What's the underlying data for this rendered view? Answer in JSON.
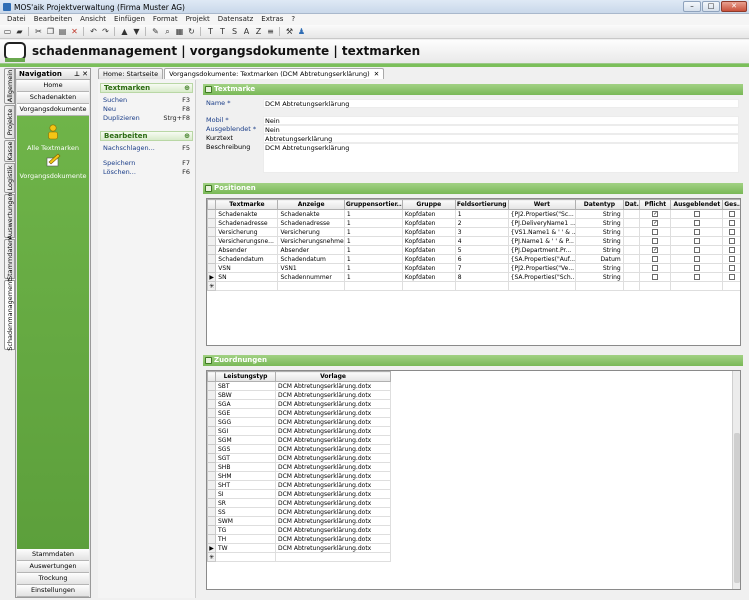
{
  "window": {
    "title": "MOS'aik Projektverwaltung (Firma Muster AG)"
  },
  "menu": [
    "Datei",
    "Bearbeiten",
    "Ansicht",
    "Einfügen",
    "Format",
    "Projekt",
    "Datensatz",
    "Extras",
    "?"
  ],
  "header": {
    "title": "schadenmanagement | vorgangsdokumente | textmarken"
  },
  "vtabs": [
    "Allgemein",
    "Projekte",
    "Kasse",
    "Logistik",
    "Auswertungen",
    "Stammdaten",
    "Schadenmanagement"
  ],
  "nav": {
    "title": "Navigation",
    "pin": "† ‡",
    "top_buttons": [
      "Home",
      "Schadenakten",
      "Vorgangsdokumente"
    ],
    "items": [
      {
        "label": "Alle Textmarken",
        "icon": "person-icon"
      },
      {
        "label": "Vorgangsdokumente",
        "icon": "pen-document-icon"
      }
    ],
    "bottom_buttons": [
      "Stammdaten",
      "Auswertungen",
      "Trockung",
      "Einstellungen"
    ]
  },
  "tabs": [
    {
      "label": "Home: Startseite"
    },
    {
      "label": "Vorgangsdokumente: Textmarken (DCM Abtretungserklärung)"
    }
  ],
  "actions": {
    "group1": {
      "title": "Textmarken",
      "rows": [
        {
          "label": "Suchen",
          "key": "F3"
        },
        {
          "label": "Neu",
          "key": "F8"
        },
        {
          "label": "Duplizieren",
          "key": "Strg+F8"
        }
      ]
    },
    "group2": {
      "title": "Bearbeiten",
      "rows": [
        {
          "label": "Nachschlagen...",
          "key": "F5"
        },
        {
          "label": "Speichern",
          "key": "F7"
        },
        {
          "label": "Löschen...",
          "key": "F6"
        }
      ]
    }
  },
  "textmarke": {
    "title": "Textmarke",
    "name_label": "Name *",
    "name_value": "DCM Abtretungserklärung",
    "mobil_label": "Mobil *",
    "mobil_value": "Nein",
    "ausgeblendet_label": "Ausgeblendet *",
    "ausgeblendet_value": "Nein",
    "kurztext_label": "Kurztext",
    "kurztext_value": "Abtretungserklärung",
    "beschreibung_label": "Beschreibung",
    "beschreibung_value": "DCM Abtretungserklärung"
  },
  "positionen": {
    "title": "Positionen",
    "columns": [
      "Textmarke",
      "Anzeige",
      "Gruppensortier...",
      "Gruppe",
      "Feldsortierung",
      "Wert",
      "Datentyp",
      "Dat...",
      "Pflicht",
      "Ausgeblendet",
      "Ges..."
    ],
    "rows": [
      [
        "Schadenakte",
        "Schadenakte",
        "1",
        "Kopfdaten",
        "1",
        "{PJ2.Properties(\"Sc...",
        "String",
        "",
        "x",
        "",
        ""
      ],
      [
        "Schadenadresse",
        "Schadenadresse",
        "1",
        "Kopfdaten",
        "2",
        "{PJ.DeliveryName1 ...",
        "String",
        "",
        "x",
        "",
        ""
      ],
      [
        "Versicherung",
        "Versicherung",
        "1",
        "Kopfdaten",
        "3",
        "{VS1.Name1 & ' ' & ...",
        "String",
        "",
        "",
        "",
        ""
      ],
      [
        "Versicherungsne...",
        "Versicherungsnehmer",
        "1",
        "Kopfdaten",
        "4",
        "{PJ.Name1 & ' ' & P...",
        "String",
        "",
        "",
        "",
        ""
      ],
      [
        "Absender",
        "Absender",
        "1",
        "Kopfdaten",
        "5",
        "{PJ.Department.Pr...",
        "String",
        "",
        "x",
        "",
        ""
      ],
      [
        "Schadendatum",
        "Schadendatum",
        "1",
        "Kopfdaten",
        "6",
        "{SA.Properties(\"Auf...",
        "Datum",
        "",
        "",
        "",
        ""
      ],
      [
        "VSN",
        "VSN1",
        "1",
        "Kopfdaten",
        "7",
        "{PJ2.Properties(\"Ve...",
        "String",
        "",
        "",
        "",
        ""
      ],
      [
        "SN",
        "Schadennummer",
        "1",
        "Kopfdaten",
        "8",
        "{SA.Properties(\"Sch...",
        "String",
        "",
        "",
        "",
        ""
      ]
    ]
  },
  "zuordnungen": {
    "title": "Zuordnungen",
    "columns": [
      "Leistungstyp",
      "Vorlage"
    ],
    "rows": [
      [
        "SBT",
        "DCM Abtretungserklärung.dotx"
      ],
      [
        "SBW",
        "DCM Abtretungserklärung.dotx"
      ],
      [
        "SGA",
        "DCM Abtretungserklärung.dotx"
      ],
      [
        "SGE",
        "DCM Abtretungserklärung.dotx"
      ],
      [
        "SGG",
        "DCM Abtretungserklärung.dotx"
      ],
      [
        "SGI",
        "DCM Abtretungserklärung.dotx"
      ],
      [
        "SGM",
        "DCM Abtretungserklärung.dotx"
      ],
      [
        "SGS",
        "DCM Abtretungserklärung.dotx"
      ],
      [
        "SGT",
        "DCM Abtretungserklärung.dotx"
      ],
      [
        "SHB",
        "DCM Abtretungserklärung.dotx"
      ],
      [
        "SHM",
        "DCM Abtretungserklärung.dotx"
      ],
      [
        "SHT",
        "DCM Abtretungserklärung.dotx"
      ],
      [
        "SI",
        "DCM Abtretungserklärung.dotx"
      ],
      [
        "SR",
        "DCM Abtretungserklärung.dotx"
      ],
      [
        "SS",
        "DCM Abtretungserklärung.dotx"
      ],
      [
        "SWM",
        "DCM Abtretungserklärung.dotx"
      ],
      [
        "TG",
        "DCM Abtretungserklärung.dotx"
      ],
      [
        "TH",
        "DCM Abtretungserklärung.dotx"
      ],
      [
        "TW",
        "DCM Abtretungserklärung.dotx"
      ]
    ]
  }
}
